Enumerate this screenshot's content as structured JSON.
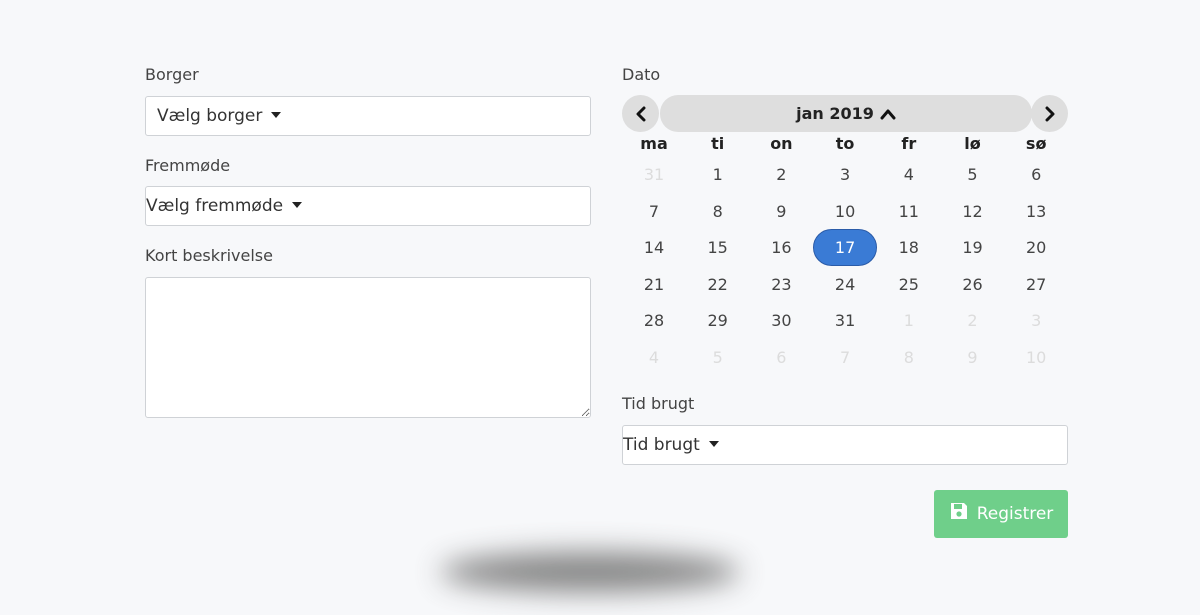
{
  "form": {
    "borger": {
      "label": "Borger",
      "value": "Vælg borger"
    },
    "fremmode": {
      "label": "Fremmøde",
      "value": "Vælg fremmøde"
    },
    "beskrivelse": {
      "label": "Kort beskrivelse",
      "value": ""
    },
    "tid": {
      "label": "Tid brugt",
      "value": "Tid brugt"
    },
    "register_label": "Registrer"
  },
  "calendar": {
    "label": "Dato",
    "title": "jan 2019",
    "weekdays": [
      "ma",
      "ti",
      "on",
      "to",
      "fr",
      "lø",
      "sø"
    ],
    "weeks": [
      [
        {
          "d": "31",
          "m": true
        },
        {
          "d": "1"
        },
        {
          "d": "2"
        },
        {
          "d": "3"
        },
        {
          "d": "4"
        },
        {
          "d": "5"
        },
        {
          "d": "6"
        }
      ],
      [
        {
          "d": "7"
        },
        {
          "d": "8"
        },
        {
          "d": "9"
        },
        {
          "d": "10"
        },
        {
          "d": "11"
        },
        {
          "d": "12"
        },
        {
          "d": "13"
        }
      ],
      [
        {
          "d": "14"
        },
        {
          "d": "15"
        },
        {
          "d": "16"
        },
        {
          "d": "17",
          "s": true
        },
        {
          "d": "18"
        },
        {
          "d": "19"
        },
        {
          "d": "20"
        }
      ],
      [
        {
          "d": "21"
        },
        {
          "d": "22"
        },
        {
          "d": "23"
        },
        {
          "d": "24"
        },
        {
          "d": "25"
        },
        {
          "d": "26"
        },
        {
          "d": "27"
        }
      ],
      [
        {
          "d": "28"
        },
        {
          "d": "29"
        },
        {
          "d": "30"
        },
        {
          "d": "31"
        },
        {
          "d": "1",
          "m": true
        },
        {
          "d": "2",
          "m": true
        },
        {
          "d": "3",
          "m": true
        }
      ],
      [
        {
          "d": "4",
          "m": true
        },
        {
          "d": "5",
          "m": true
        },
        {
          "d": "6",
          "m": true
        },
        {
          "d": "7",
          "m": true
        },
        {
          "d": "8",
          "m": true
        },
        {
          "d": "9",
          "m": true
        },
        {
          "d": "10",
          "m": true
        }
      ]
    ],
    "selected_day": "17"
  },
  "colors": {
    "accent": "#3a7bd5",
    "register": "#6fcf8a",
    "background": "#f7f8fa"
  },
  "icons": {
    "prev": "chevron-left-icon",
    "next": "chevron-right-icon",
    "title_toggle": "chevron-up-icon",
    "register": "floppy-disk-icon"
  }
}
